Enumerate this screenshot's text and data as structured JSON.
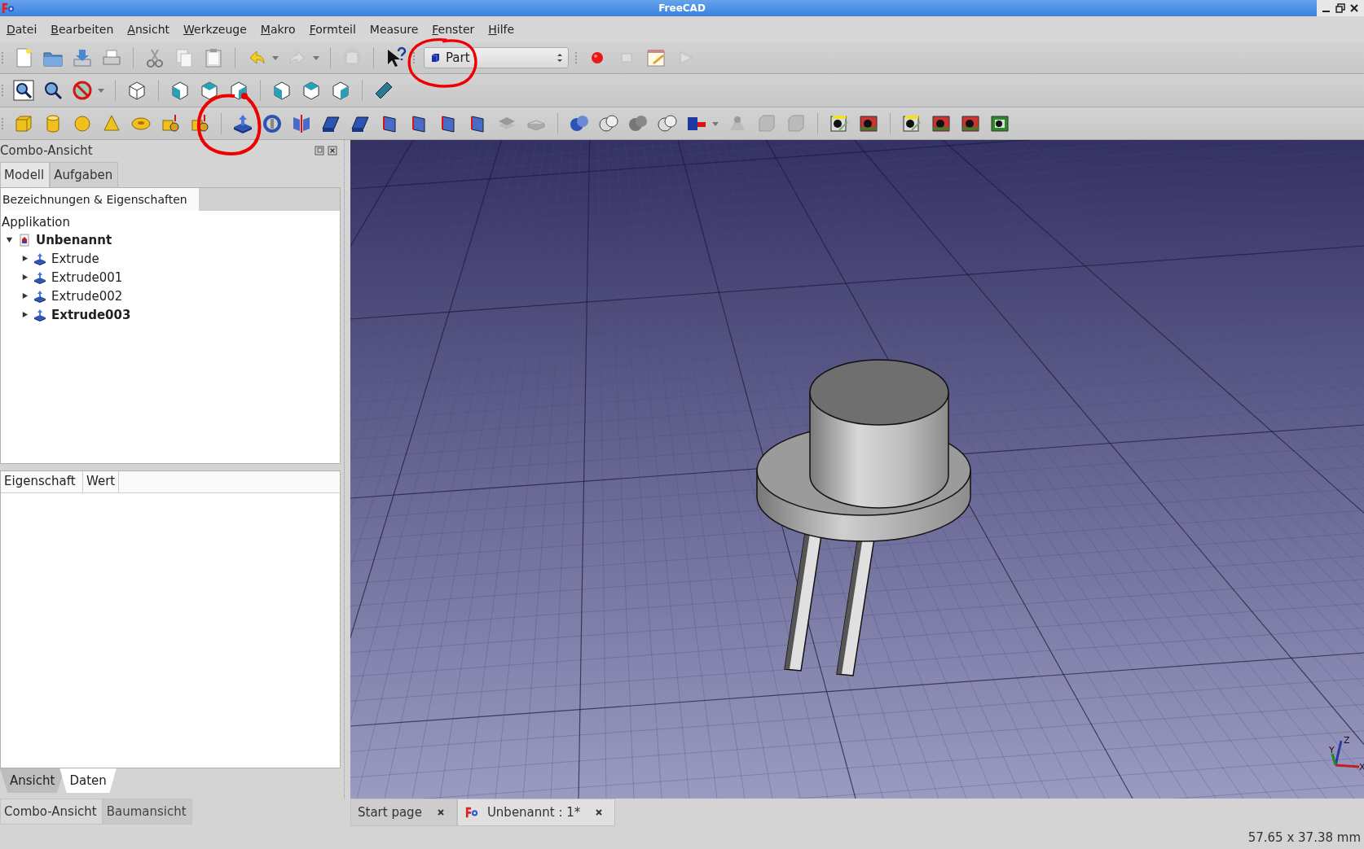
{
  "window": {
    "title": "FreeCAD"
  },
  "menu": [
    {
      "label": "Datei",
      "mnemonic": true
    },
    {
      "label": "Bearbeiten",
      "mnemonic": true
    },
    {
      "label": "Ansicht",
      "mnemonic": true
    },
    {
      "label": "Werkzeuge",
      "mnemonic": true
    },
    {
      "label": "Makro",
      "mnemonic": true
    },
    {
      "label": "Formteil",
      "mnemonic": true
    },
    {
      "label": "Measure",
      "mnemonic": false
    },
    {
      "label": "Fenster",
      "mnemonic": true
    },
    {
      "label": "Hilfe",
      "mnemonic": true
    }
  ],
  "workbench_selector": {
    "value": "Part"
  },
  "combo_view": {
    "title": "Combo-Ansicht",
    "tabs": [
      {
        "label": "Modell",
        "selected": true
      },
      {
        "label": "Aufgaben",
        "selected": false
      }
    ],
    "tree_header": "Bezeichnungen & Eigenschaften",
    "tree_root": "Applikation",
    "tree": [
      {
        "label": "Unbenannt",
        "kind": "document",
        "bold": true,
        "expanded": true,
        "children": [
          {
            "label": "Extrude",
            "kind": "extrude",
            "bold": false,
            "expanded": false
          },
          {
            "label": "Extrude001",
            "kind": "extrude",
            "bold": false,
            "expanded": false
          },
          {
            "label": "Extrude002",
            "kind": "extrude",
            "bold": false,
            "expanded": false
          },
          {
            "label": "Extrude003",
            "kind": "extrude",
            "bold": true,
            "expanded": false
          }
        ]
      }
    ],
    "property_columns": [
      "Eigenschaft",
      "Wert"
    ],
    "property_tabs": [
      {
        "label": "Ansicht",
        "selected": false
      },
      {
        "label": "Daten",
        "selected": true
      }
    ]
  },
  "dock_tabs": [
    {
      "label": "Combo-Ansicht",
      "selected": true
    },
    {
      "label": "Baumansicht",
      "selected": false
    }
  ],
  "document_tabs": [
    {
      "label": "Start page",
      "selected": false,
      "kind": "page"
    },
    {
      "label": "Unbenannt : 1*",
      "selected": true,
      "kind": "document"
    }
  ],
  "axis_labels": [
    "Z",
    "Y",
    "X"
  ],
  "status_bar": {
    "dimensions": "57.65 x 37.38 mm"
  }
}
